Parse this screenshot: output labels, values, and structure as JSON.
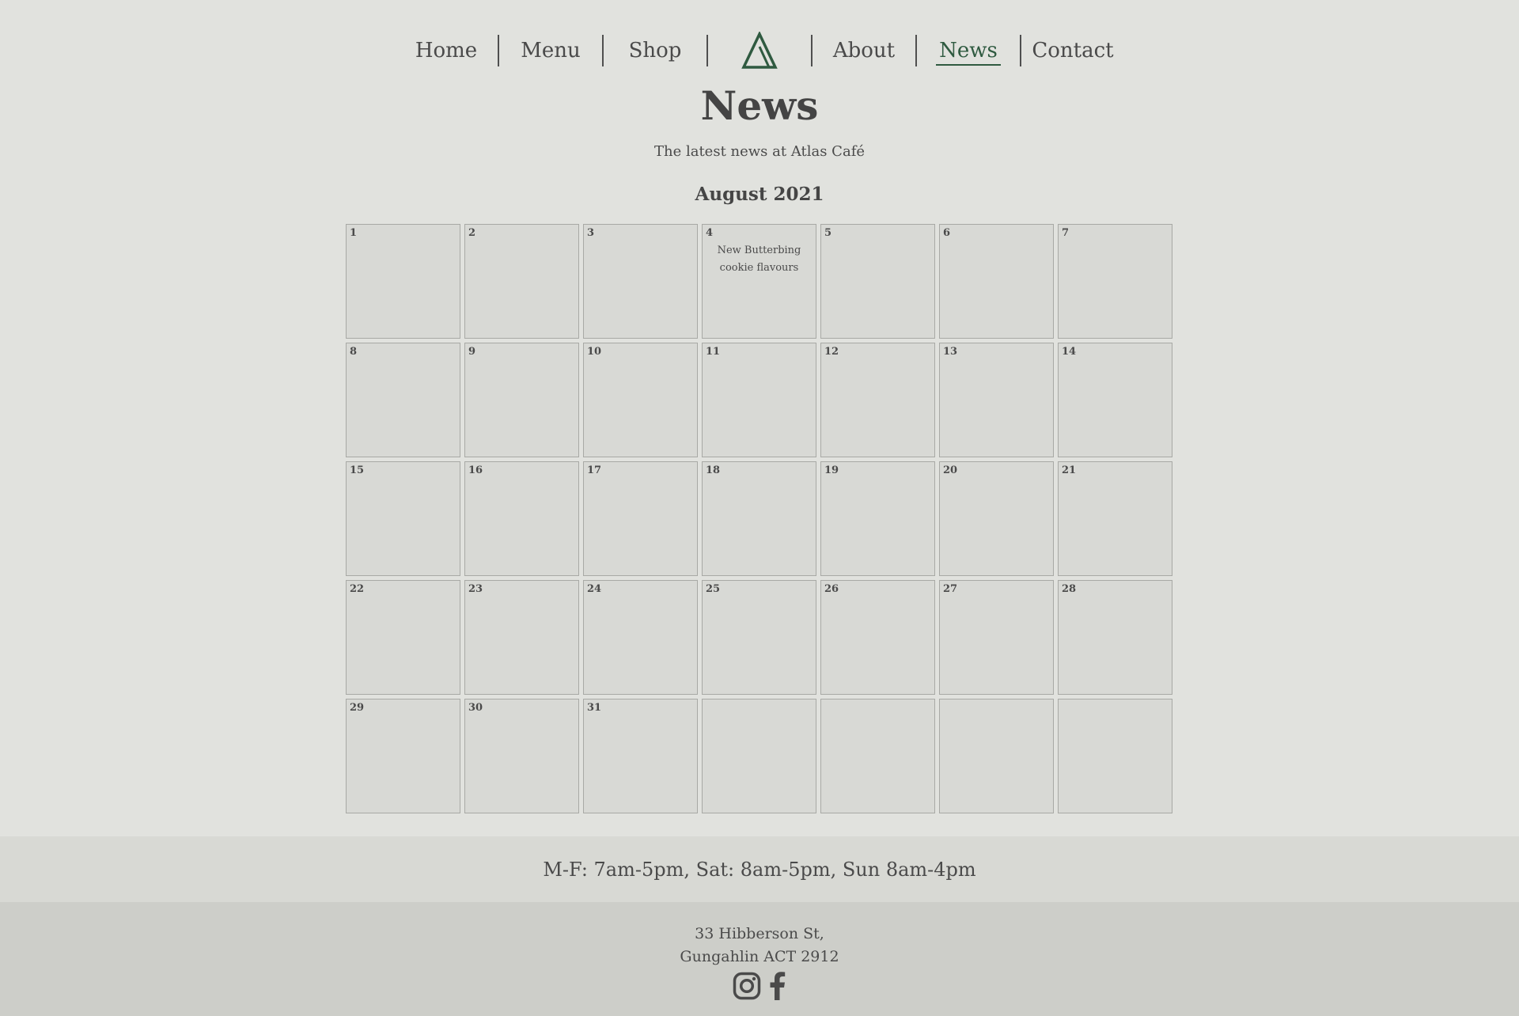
{
  "nav": {
    "items": [
      {
        "label": "Home",
        "active": false
      },
      {
        "label": "Menu",
        "active": false
      },
      {
        "label": "Shop",
        "active": false
      },
      {
        "label": "About",
        "active": false
      },
      {
        "label": "News",
        "active": true
      },
      {
        "label": "Contact",
        "active": false
      }
    ],
    "logo_icon": "triangle-logo-icon",
    "accent_color": "#2f5a40"
  },
  "page": {
    "title": "News",
    "subtitle": "The latest news at Atlas Café"
  },
  "calendar": {
    "month_label": "August 2021",
    "cells": [
      {
        "day": "1",
        "event": ""
      },
      {
        "day": "2",
        "event": ""
      },
      {
        "day": "3",
        "event": ""
      },
      {
        "day": "4",
        "event": "New Butterbing cookie flavours"
      },
      {
        "day": "5",
        "event": ""
      },
      {
        "day": "6",
        "event": ""
      },
      {
        "day": "7",
        "event": ""
      },
      {
        "day": "8",
        "event": ""
      },
      {
        "day": "9",
        "event": ""
      },
      {
        "day": "10",
        "event": ""
      },
      {
        "day": "11",
        "event": ""
      },
      {
        "day": "12",
        "event": ""
      },
      {
        "day": "13",
        "event": ""
      },
      {
        "day": "14",
        "event": ""
      },
      {
        "day": "15",
        "event": ""
      },
      {
        "day": "16",
        "event": ""
      },
      {
        "day": "17",
        "event": ""
      },
      {
        "day": "18",
        "event": ""
      },
      {
        "day": "19",
        "event": ""
      },
      {
        "day": "20",
        "event": ""
      },
      {
        "day": "21",
        "event": ""
      },
      {
        "day": "22",
        "event": ""
      },
      {
        "day": "23",
        "event": ""
      },
      {
        "day": "24",
        "event": ""
      },
      {
        "day": "25",
        "event": ""
      },
      {
        "day": "26",
        "event": ""
      },
      {
        "day": "27",
        "event": ""
      },
      {
        "day": "28",
        "event": ""
      },
      {
        "day": "29",
        "event": ""
      },
      {
        "day": "30",
        "event": ""
      },
      {
        "day": "31",
        "event": ""
      },
      {
        "day": "",
        "event": ""
      },
      {
        "day": "",
        "event": ""
      },
      {
        "day": "",
        "event": ""
      },
      {
        "day": "",
        "event": ""
      }
    ]
  },
  "footer": {
    "hours": "M-F: 7am-5pm, Sat: 8am-5pm, Sun 8am-4pm",
    "address_line1": "33 Hibberson St,",
    "address_line2": "Gungahlin ACT 2912",
    "socials": [
      {
        "icon": "instagram-icon"
      },
      {
        "icon": "facebook-icon"
      }
    ]
  }
}
